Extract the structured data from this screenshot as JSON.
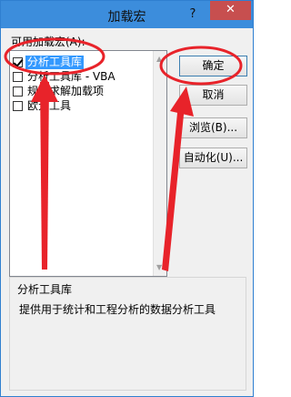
{
  "window": {
    "title": "加载宏",
    "help_glyph": "?",
    "close_glyph": "✕"
  },
  "addins": {
    "label": "可用加载宏(A):",
    "items": [
      {
        "label": "分析工具库",
        "checked": true,
        "selected": true
      },
      {
        "label": "分析工具库 - VBA",
        "checked": false,
        "selected": false
      },
      {
        "label": "规划求解加载项",
        "checked": false,
        "selected": false
      },
      {
        "label": "欧元工具",
        "checked": false,
        "selected": false
      }
    ]
  },
  "buttons": {
    "ok": "确定",
    "cancel": "取消",
    "browse": "浏览(B)...",
    "automation": "自动化(U)..."
  },
  "description": {
    "title": "分析工具库",
    "text": "提供用于统计和工程分析的数据分析工具"
  },
  "annotation_color": "#e8232a"
}
